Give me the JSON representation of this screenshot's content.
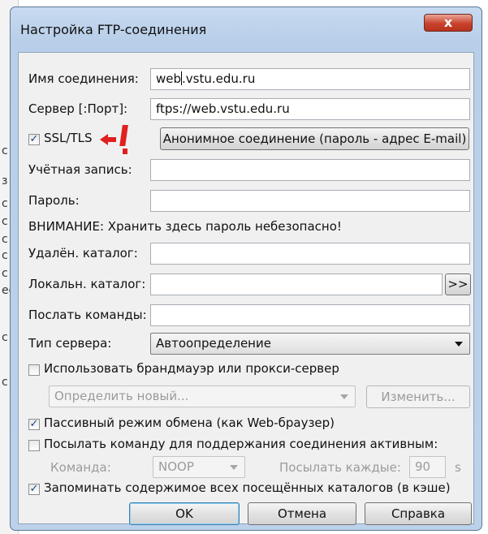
{
  "window": {
    "title": "Настройка FTP-соединения",
    "close_glyph": "x"
  },
  "background": {
    "letters": [
      "с",
      "з",
      "с",
      "с",
      "с",
      "с",
      "с",
      "ес",
      "с",
      "с"
    ]
  },
  "fields": {
    "connection_name": {
      "label": "Имя соединения:",
      "value_before": "web",
      "value_after": ".vstu.edu.ru"
    },
    "server": {
      "label": "Сервер [:Порт]:",
      "value": "ftps://web.vstu.edu.ru"
    },
    "ssl": {
      "label": "SSL/TLS",
      "checked": true
    },
    "anonymous_button": "Анонимное соединение (пароль - адрес E-mail)",
    "account": {
      "label": "Учётная запись:",
      "value": ""
    },
    "password": {
      "label": "Пароль:",
      "value": ""
    },
    "warning": "ВНИМАНИЕ: Хранить здесь пароль небезопасно!",
    "remote_dir": {
      "label": "Удалён. каталог:",
      "value": ""
    },
    "local_dir": {
      "label": "Локальн. каталог:",
      "value": "",
      "browse": ">>"
    },
    "send_commands": {
      "label": "Послать команды:",
      "value": ""
    },
    "server_type": {
      "label": "Тип сервера:",
      "value": "Автоопределение"
    }
  },
  "firewall": {
    "label": "Использовать брандмауэр или прокси-сервер",
    "checked": false,
    "select": "Определить новый...",
    "change_button": "Изменить..."
  },
  "passive": {
    "label": "Пассивный режим обмена (как Web-браузер)",
    "checked": true
  },
  "keepalive": {
    "label": "Посылать команду для поддержания соединения активным:",
    "checked": false,
    "command_label": "Команда:",
    "command_value": "NOOP",
    "interval_label": "Посылать каждые:",
    "interval_value": "90",
    "unit": "s"
  },
  "cache": {
    "label": "Запоминать содержимое всех посещённых каталогов (в кэше)",
    "checked": true
  },
  "buttons": {
    "ok": "OK",
    "cancel": "Отмена",
    "help": "Справка"
  },
  "colors": {
    "title_bar": "#c7daf0",
    "close_button": "#c8432d",
    "annotation": "#e02020"
  }
}
